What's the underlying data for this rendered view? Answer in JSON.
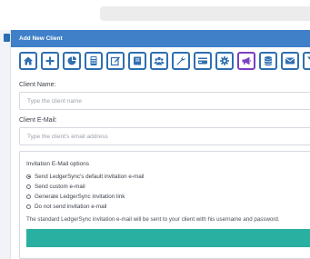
{
  "panel": {
    "title": "Add New Client"
  },
  "toolbar": {
    "buttons": [
      {
        "icon": "home-icon"
      },
      {
        "icon": "plus-icon"
      },
      {
        "icon": "pie-chart-icon"
      },
      {
        "icon": "calculator-icon"
      },
      {
        "icon": "edit-icon"
      },
      {
        "icon": "book-icon"
      },
      {
        "icon": "users-icon"
      },
      {
        "icon": "wrench-icon"
      },
      {
        "icon": "credit-card-icon"
      },
      {
        "icon": "gear-icon"
      },
      {
        "icon": "megaphone-icon"
      },
      {
        "icon": "database-icon"
      },
      {
        "icon": "envelope-icon"
      },
      {
        "icon": "filter-icon"
      }
    ],
    "active_icon": "megaphone-icon",
    "accent_color": "#2f6fb2",
    "active_color": "#7b3fc4"
  },
  "form": {
    "client_name_label": "Client Name:",
    "client_name_placeholder": "Type the client name",
    "client_email_label": "Client E-Mail:",
    "client_email_placeholder": "Type the client's email address"
  },
  "invitation": {
    "title": "Invitation E-Mail options",
    "options": [
      {
        "label": "Send LedgerSync's default invitation e-mail",
        "checked": true
      },
      {
        "label": "Send custom e-mail",
        "checked": false
      },
      {
        "label": "Generate LedgerSync invitation link",
        "checked": false
      },
      {
        "label": "Do not send invitation e-mail",
        "checked": false
      }
    ],
    "info_text": "The standard LedgerSync invitation e-mail will be sent to your client with his username and password."
  },
  "colors": {
    "header_blue": "#3f80c8",
    "teal_bar": "#2ab0a0"
  }
}
